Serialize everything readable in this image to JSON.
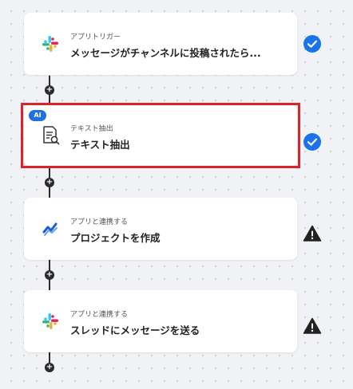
{
  "steps": [
    {
      "subtitle": "アプリトリガー",
      "title": "メッセージがチャンネルに投稿されたら...",
      "icon": "slack-icon",
      "status": "success"
    },
    {
      "subtitle": "テキスト抽出",
      "title": "テキスト抽出",
      "icon": "document-scan-icon",
      "status": "success",
      "badge": "AI"
    },
    {
      "subtitle": "アプリと連携する",
      "title": "プロジェクトを作成",
      "icon": "app-logo-icon",
      "status": "warning"
    },
    {
      "subtitle": "アプリと連携する",
      "title": "スレッドにメッセージを送る",
      "icon": "slack-icon",
      "status": "warning"
    }
  ],
  "colors": {
    "success": "#1a73e8",
    "warning": "#222222",
    "selected_border": "#d9242b",
    "badge": "#1f6fe5"
  }
}
